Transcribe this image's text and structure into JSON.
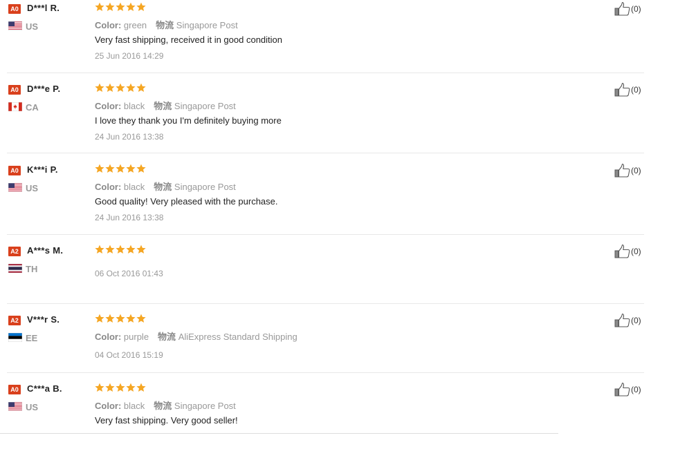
{
  "reviews": [
    {
      "level": "A0",
      "name": "D***l R.",
      "country": "US",
      "flag": "us",
      "rating": 5,
      "color_label": "Color:",
      "color_value": "green",
      "ship_label": "物流",
      "ship_value": "Singapore Post",
      "comment": "Very fast shipping, received it in good condition",
      "date": "25 Jun 2016 14:29",
      "likes": "(0)"
    },
    {
      "level": "A0",
      "name": "D***e P.",
      "country": "CA",
      "flag": "ca",
      "rating": 5,
      "color_label": "Color:",
      "color_value": "black",
      "ship_label": "物流",
      "ship_value": "Singapore Post",
      "comment": "I love they thank you I'm definitely buying more",
      "date": "24 Jun 2016 13:38",
      "likes": "(0)"
    },
    {
      "level": "A0",
      "name": "K***i P.",
      "country": "US",
      "flag": "us",
      "rating": 5,
      "color_label": "Color:",
      "color_value": "black",
      "ship_label": "物流",
      "ship_value": "Singapore Post",
      "comment": "Good quality! Very pleased with the purchase.",
      "date": "24 Jun 2016 13:38",
      "likes": "(0)"
    },
    {
      "level": "A2",
      "name": "A***s M.",
      "country": "TH",
      "flag": "th",
      "rating": 5,
      "date": "06 Oct 2016 01:43",
      "likes": "(0)"
    },
    {
      "level": "A2",
      "name": "V***r S.",
      "country": "EE",
      "flag": "ee",
      "rating": 5,
      "color_label": "Color:",
      "color_value": "purple",
      "ship_label": "物流",
      "ship_value": "AliExpress Standard Shipping",
      "date": "04 Oct 2016 15:19",
      "likes": "(0)"
    },
    {
      "level": "A0",
      "name": "C***a B.",
      "country": "US",
      "flag": "us",
      "rating": 5,
      "color_label": "Color:",
      "color_value": "black",
      "ship_label": "物流",
      "ship_value": "Singapore Post",
      "comment": "Very fast shipping. Very good seller!",
      "likes": "(0)"
    }
  ],
  "icons": {
    "star": "star-icon",
    "thumb": "thumbs-up-icon"
  },
  "colors": {
    "badge": "#d9401c",
    "star": "#f5a623",
    "muted": "#999999"
  }
}
